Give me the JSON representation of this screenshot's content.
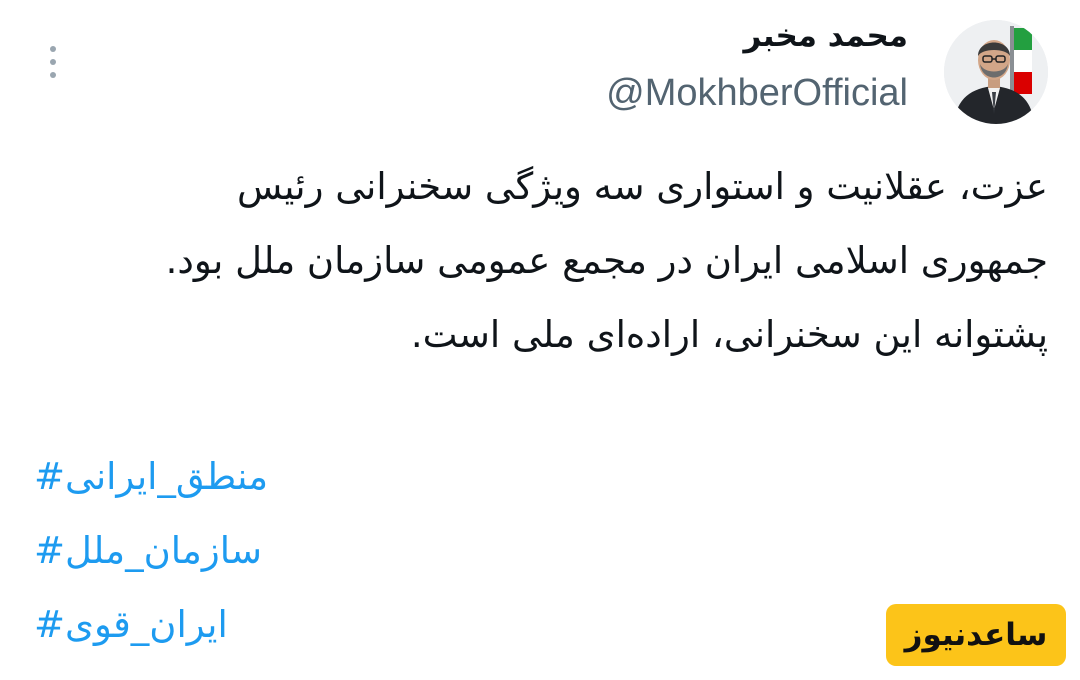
{
  "author": {
    "display_name": "محمد مخبر",
    "handle": "@MokhberOfficial"
  },
  "tweet": {
    "text_lines": [
      "عزت، عقلانیت و استواری سه ویژگی سخنرانی رئیس",
      "جمهوری اسلامی ایران در مجمع عمومی سازمان ملل بود.",
      "پشتوانه این سخنرانی، اراده‌ای ملی است."
    ],
    "hashtags": [
      "#منطق_ایرانی",
      "#سازمان_ملل",
      "#ایران_قوی"
    ]
  },
  "watermark": {
    "text": "ساعدنیوز"
  },
  "icons": {
    "more": "more-vertical-icon",
    "avatar": "profile-photo"
  },
  "colors": {
    "text": "#0f1419",
    "secondary": "#536471",
    "hashtag": "#1d9bf0",
    "watermark_bg": "#fcc419"
  }
}
